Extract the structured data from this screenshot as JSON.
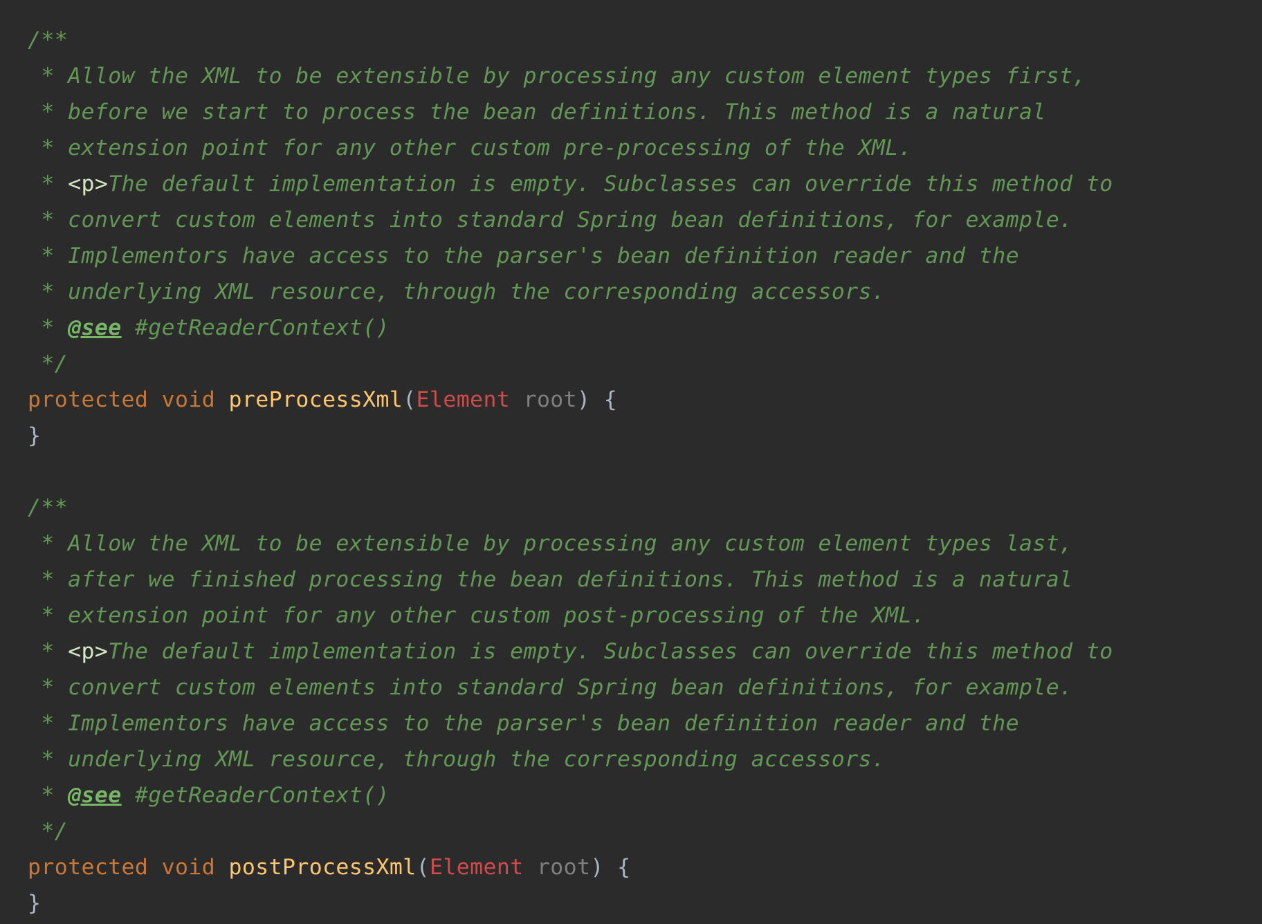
{
  "blocks": [
    {
      "comment": {
        "open": "/**",
        "lines": [
          " * Allow the XML to be extensible by processing any custom element types first,",
          " * before we start to process the bean definitions. This method is a natural",
          " * extension point for any other custom pre-processing of the XML."
        ],
        "p_prefix": " * ",
        "p_tag": "<p>",
        "p_text": "The default implementation is empty. Subclasses can override this method to",
        "lines2": [
          " * convert custom elements into standard Spring bean definitions, for example.",
          " * Implementors have access to the parser's bean definition reader and the",
          " * underlying XML resource, through the corresponding accessors."
        ],
        "see_prefix": " * ",
        "see_tag": "@see",
        "see_ref": " #getReaderContext()",
        "close": " */"
      },
      "signature": {
        "modifier": "protected",
        "return_type": "void",
        "method_name": "preProcessXml",
        "open_paren": "(",
        "param_type": "Element",
        "param_name": "root",
        "close": ") {"
      },
      "closing_brace": "}"
    },
    {
      "comment": {
        "open": "/**",
        "lines": [
          " * Allow the XML to be extensible by processing any custom element types last,",
          " * after we finished processing the bean definitions. This method is a natural",
          " * extension point for any other custom post-processing of the XML."
        ],
        "p_prefix": " * ",
        "p_tag": "<p>",
        "p_text": "The default implementation is empty. Subclasses can override this method to",
        "lines2": [
          " * convert custom elements into standard Spring bean definitions, for example.",
          " * Implementors have access to the parser's bean definition reader and the",
          " * underlying XML resource, through the corresponding accessors."
        ],
        "see_prefix": " * ",
        "see_tag": "@see",
        "see_ref": " #getReaderContext()",
        "close": " */"
      },
      "signature": {
        "modifier": "protected",
        "return_type": "void",
        "method_name": "postProcessXml",
        "open_paren": "(",
        "param_type": "Element",
        "param_name": "root",
        "close": ") {"
      },
      "closing_brace": "}"
    }
  ],
  "colors": {
    "background": "#2b2b2b",
    "comment": "#629755",
    "keyword": "#cc7832",
    "method": "#ffc66d",
    "type": "#cf4b4b",
    "parameter": "#808080",
    "default_text": "#a9b7c6"
  }
}
